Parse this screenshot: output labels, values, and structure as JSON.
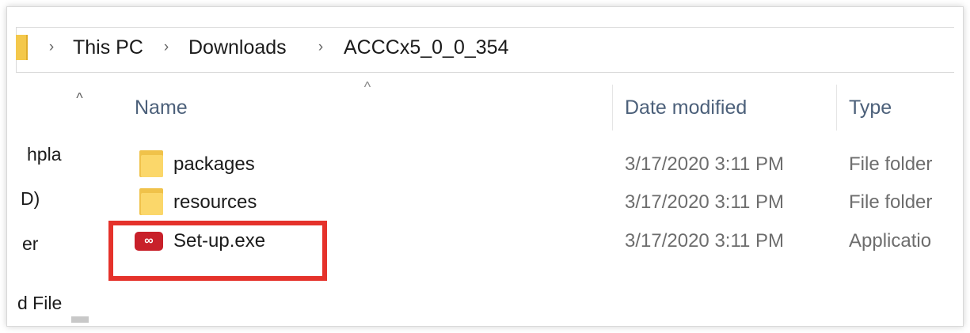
{
  "breadcrumb": {
    "items": [
      "This PC",
      "Downloads",
      "ACCCx5_0_0_354"
    ],
    "separator": "›"
  },
  "nav_pane": {
    "items": [
      "hpla",
      "D)",
      "er",
      "d File"
    ],
    "scroll_up_glyph": "^"
  },
  "file_list": {
    "sort_glyph": "^",
    "columns": [
      "Name",
      "Date modified",
      "Type"
    ],
    "rows": [
      {
        "name": "packages",
        "date": "3/17/2020 3:11 PM",
        "type": "File folder",
        "icon": "folder-icon"
      },
      {
        "name": "resources",
        "date": "3/17/2020 3:11 PM",
        "type": "File folder",
        "icon": "folder-icon"
      },
      {
        "name": "Set-up.exe",
        "date": "3/17/2020 3:11 PM",
        "type": "Applicatio",
        "icon": "creative-cloud-icon"
      }
    ]
  },
  "annotation": {
    "highlight_color": "#e5322b",
    "highlights": "Set-up.exe"
  },
  "colors": {
    "header_text": "#4c607a",
    "secondary_text": "#6d6d6d",
    "folder": "#f0c24a",
    "app_icon": "#c8202a"
  }
}
